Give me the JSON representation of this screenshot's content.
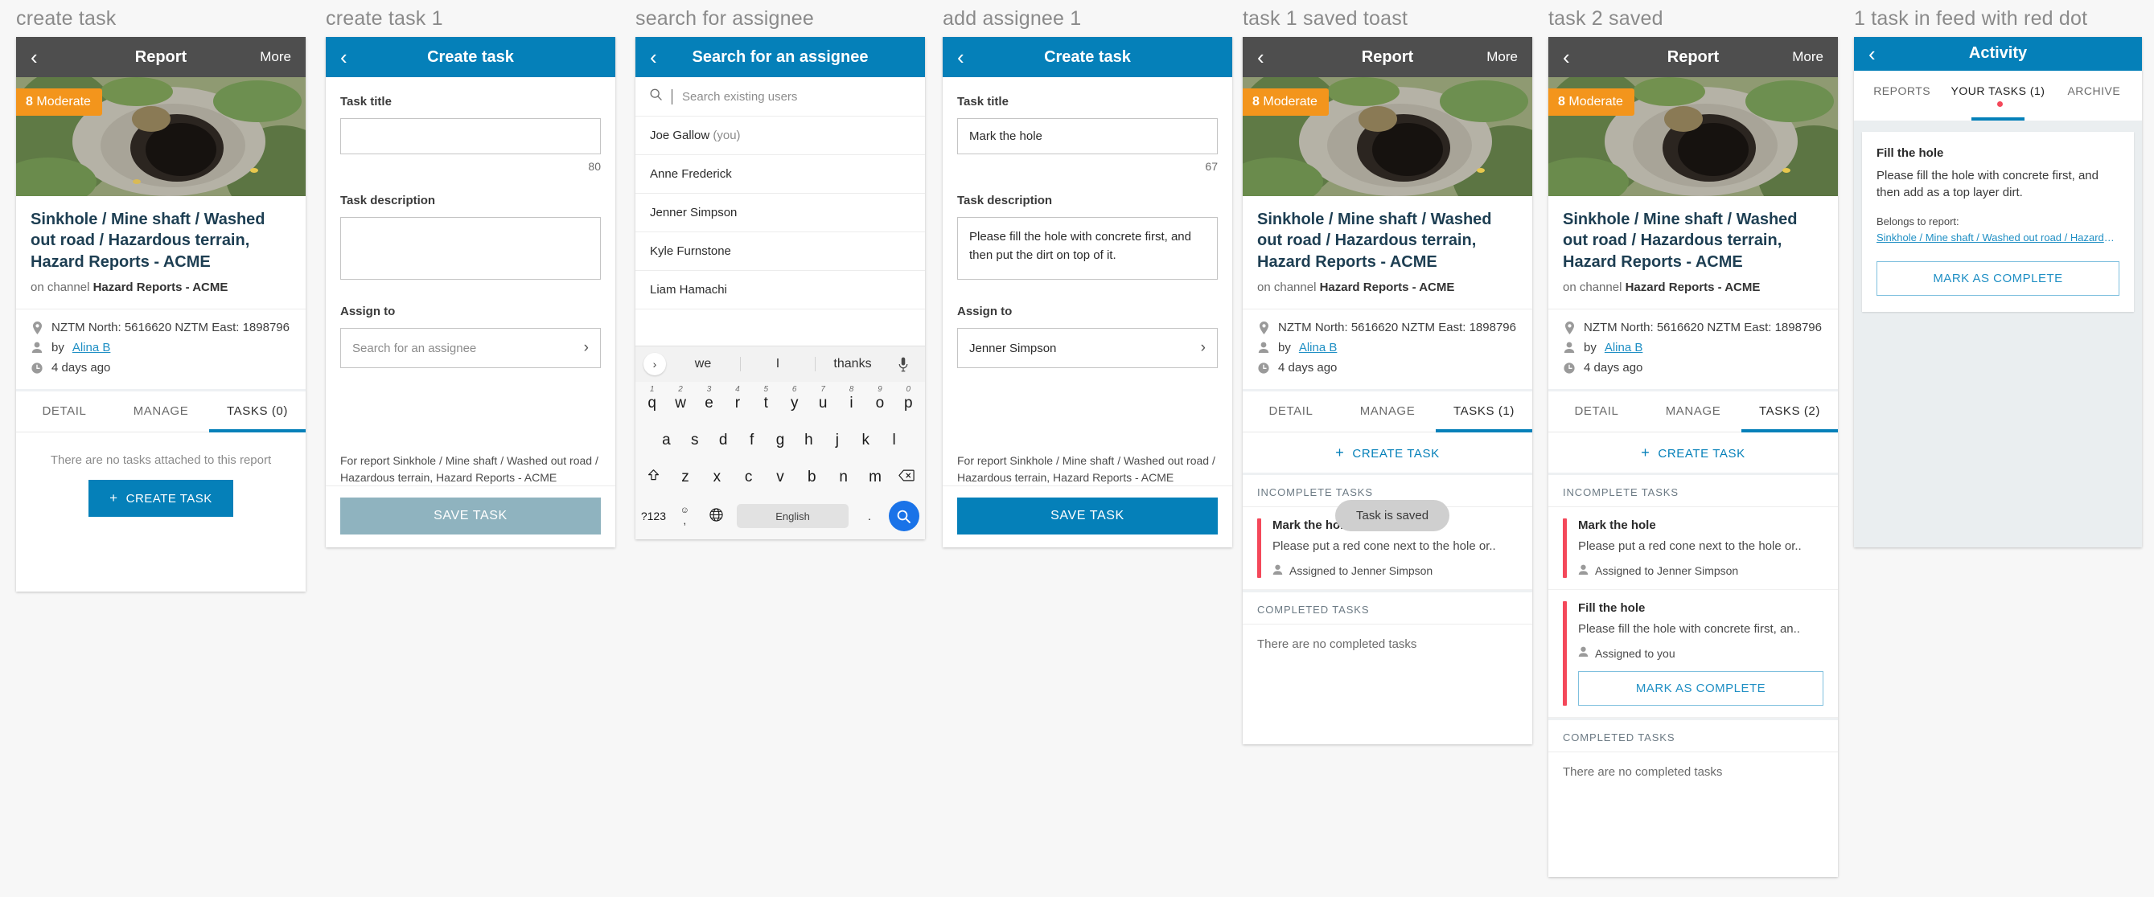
{
  "panels": [
    {
      "caption": "create task"
    },
    {
      "caption": "create task 1"
    },
    {
      "caption": "search for assignee"
    },
    {
      "caption": "add assignee 1"
    },
    {
      "caption": "task 1 saved toast"
    },
    {
      "caption": "task 2 saved"
    },
    {
      "caption": "1 task in feed with red dot"
    }
  ],
  "report": {
    "appbar": {
      "title": "Report",
      "more": "More",
      "back_icon": "chevron-left-icon"
    },
    "badge": {
      "score": "8",
      "level": "Moderate",
      "color": "#f3951c"
    },
    "title": "Sinkhole / Mine shaft / Washed out road / Hazardous terrain, Hazard Reports - ACME",
    "channel_prefix": "on channel ",
    "channel_name": "Hazard Reports - ACME",
    "coordinates": "NZTM North: 5616620 NZTM East: 1898796",
    "author_prefix": "by ",
    "author": "Alina B",
    "time": "4 days ago",
    "tabs": {
      "detail": "DETAIL",
      "manage": "MANAGE",
      "tasks_0": "TASKS (0)",
      "tasks_1": "TASKS (1)",
      "tasks_2": "TASKS (2)"
    },
    "no_tasks_note": "There are no tasks attached to this report",
    "create_task_button": "CREATE TASK",
    "create_task_link": "CREATE TASK",
    "incomplete_header": "INCOMPLETE TASKS",
    "completed_header": "COMPLETED TASKS",
    "no_completed": "There are no completed tasks",
    "toast": "Task is saved"
  },
  "tasks": [
    {
      "title": "Mark the hole",
      "desc": "Please put a red cone next to the hole or..",
      "assignee": "Assigned to Jenner Simpson",
      "bar_color": "#f4485a",
      "has_complete_button": false
    },
    {
      "title": "Fill the hole",
      "desc": "Please fill the hole with concrete first, an..",
      "assignee": "Assigned to you",
      "bar_color": "#f4485a",
      "has_complete_button": true,
      "complete_label": "MARK AS COMPLETE"
    }
  ],
  "create_task": {
    "appbar_title": "Create task",
    "task_title_label": "Task title",
    "task_title_empty": "",
    "task_title_filled": "Mark the hole",
    "char_count_empty": "80",
    "char_count_filled": "67",
    "task_desc_label": "Task description",
    "task_desc_empty": "",
    "task_desc_filled": "Please fill the hole with concrete first, and then put the dirt on top of it.",
    "assign_label": "Assign to",
    "assign_placeholder": "Search for an assignee",
    "assign_value": "Jenner Simpson",
    "for_report": "For report Sinkhole / Mine shaft / Washed out road / Hazardous terrain, Hazard Reports - ACME",
    "save_label": "SAVE TASK",
    "chevron_icon": "chevron-right-icon"
  },
  "assignee_search": {
    "appbar_title": "Search for an assignee",
    "search_placeholder": "Search existing users",
    "search_icon": "magnifier-icon",
    "users": [
      {
        "name": "Joe Gallow",
        "suffix": " (you)"
      },
      {
        "name": "Anne Frederick",
        "suffix": ""
      },
      {
        "name": "Jenner Simpson",
        "suffix": ""
      },
      {
        "name": "Kyle Furnstone",
        "suffix": ""
      },
      {
        "name": "Liam Hamachi",
        "suffix": ""
      }
    ]
  },
  "keyboard": {
    "suggestions": [
      "we",
      "I",
      "thanks"
    ],
    "expand_icon": "chevron-right-icon",
    "mic_icon": "microphone-icon",
    "row1": [
      {
        "k": "q",
        "n": "1"
      },
      {
        "k": "w",
        "n": "2"
      },
      {
        "k": "e",
        "n": "3"
      },
      {
        "k": "r",
        "n": "4"
      },
      {
        "k": "t",
        "n": "5"
      },
      {
        "k": "y",
        "n": "6"
      },
      {
        "k": "u",
        "n": "7"
      },
      {
        "k": "i",
        "n": "8"
      },
      {
        "k": "o",
        "n": "9"
      },
      {
        "k": "p",
        "n": "0"
      }
    ],
    "row2": [
      "a",
      "s",
      "d",
      "f",
      "g",
      "h",
      "j",
      "k",
      "l"
    ],
    "row3": [
      "z",
      "x",
      "c",
      "v",
      "b",
      "n",
      "m"
    ],
    "shift_icon": "shift-icon",
    "backspace_icon": "backspace-icon",
    "symbols_key": "?123",
    "emoji_key": ",",
    "globe_icon": "globe-icon",
    "spacebar": "English",
    "period_key": ".",
    "enter_icon": "search-icon"
  },
  "activity": {
    "appbar_title": "Activity",
    "tabs": [
      {
        "label": "REPORTS",
        "active": false,
        "dot": false
      },
      {
        "label": "YOUR TASKS (1)",
        "active": true,
        "dot": true
      },
      {
        "label": "ARCHIVE",
        "active": false,
        "dot": false
      }
    ],
    "card": {
      "title": "Fill the hole",
      "desc": "Please fill the hole with concrete first, and then add as a top layer dirt.",
      "belongs_label": "Belongs to report:",
      "report_link": "Sinkhole / Mine shaft / Washed out road / Hazardous te...",
      "complete_label": "MARK AS COMPLETE"
    }
  }
}
